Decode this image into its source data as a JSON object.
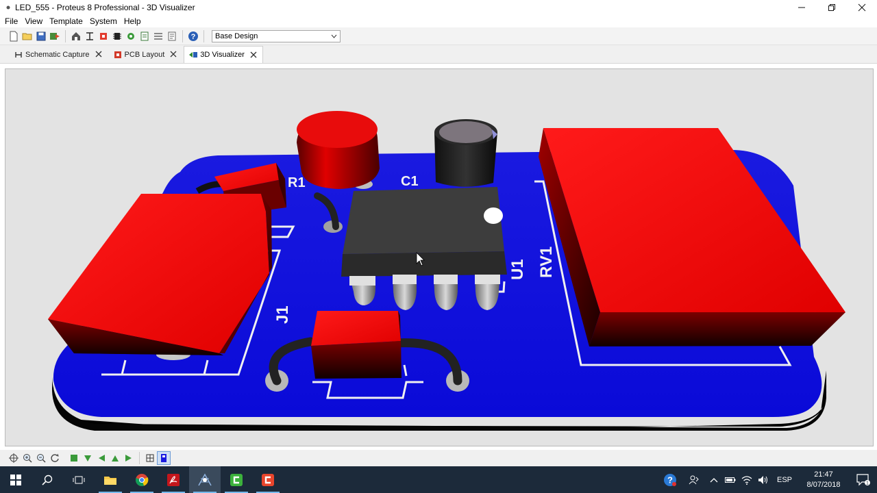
{
  "window": {
    "title": "LED_555 - Proteus 8 Professional - 3D Visualizer",
    "minimize_glyph": "—",
    "restore_glyph": "❐",
    "close_glyph": "✕"
  },
  "menu": [
    "File",
    "View",
    "Template",
    "System",
    "Help"
  ],
  "toolbar": {
    "icons": [
      "new-file-icon",
      "open-folder-icon",
      "save-icon",
      "import-icon",
      "home-icon",
      "schematic-icon",
      "pcb-icon",
      "chip-icon",
      "gerber-icon",
      "bom-icon",
      "design-explorer-icon",
      "notes-icon",
      "help-icon"
    ],
    "variant_select": "Base Design"
  },
  "tabs": [
    {
      "label": "Schematic Capture",
      "icon": "schematic-tab-icon",
      "active": false
    },
    {
      "label": "PCB Layout",
      "icon": "pcb-tab-icon",
      "active": false
    },
    {
      "label": "3D Visualizer",
      "icon": "3d-tab-icon",
      "active": true
    }
  ],
  "board": {
    "silkscreen": {
      "r1": "R1",
      "c1": "C1",
      "u1": "U1",
      "rv1": "RV1",
      "j1": "J1"
    },
    "colors": {
      "board": "#1414e6",
      "component": "#e60000",
      "ic": "#3a3a3a",
      "silk": "#f2f2f2"
    }
  },
  "viewbar_icons": [
    "pan-icon",
    "zoom-in-icon",
    "zoom-out-icon",
    "rotate-icon",
    "top-view-icon",
    "front-view-icon",
    "left-view-icon",
    "back-view-icon",
    "right-view-icon",
    "bottom-view-icon",
    "board-toggle-icon",
    "render-icon"
  ],
  "taskbar": {
    "apps": [
      "windows-start-icon",
      "search-icon",
      "task-view-icon",
      "file-explorer-icon",
      "chrome-icon",
      "acrobat-icon",
      "proteus-icon",
      "camtasia-green-icon",
      "camtasia-icon"
    ],
    "language": "ESP",
    "time": "21:47",
    "date": "8/07/2018",
    "notification_count": "1"
  }
}
